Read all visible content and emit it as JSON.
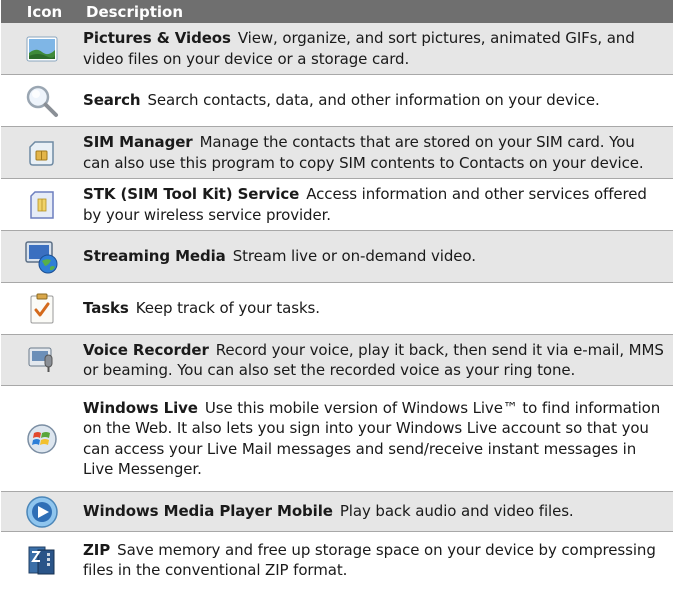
{
  "header": {
    "icon": "Icon",
    "description": "Description"
  },
  "rows": [
    {
      "icon": "pictures-videos-icon",
      "name": "Pictures & Videos",
      "text": "View, organize, and sort pictures, animated GIFs, and video files on your device or a storage card."
    },
    {
      "icon": "search-icon",
      "name": "Search",
      "text": "Search contacts, data, and other information on your device."
    },
    {
      "icon": "sim-manager-icon",
      "name": "SIM Manager",
      "text": "Manage the contacts that are stored on your SIM card. You can also use this program to copy SIM contents to Contacts on your device."
    },
    {
      "icon": "stk-service-icon",
      "name": "STK (SIM Tool Kit) Service",
      "text": "Access information and other services offered by your wireless service provider."
    },
    {
      "icon": "streaming-media-icon",
      "name": "Streaming Media",
      "text": "Stream live or on-demand video."
    },
    {
      "icon": "tasks-icon",
      "name": "Tasks",
      "text": "Keep track of your tasks."
    },
    {
      "icon": "voice-recorder-icon",
      "name": "Voice Recorder",
      "text": "Record your voice, play it back, then send it via e-mail, MMS or beaming. You can also set the recorded voice as your ring tone."
    },
    {
      "icon": "windows-live-icon",
      "name": "Windows Live",
      "text": "Use this mobile version of Windows Live™ to find information on the Web. It also lets you sign into your Windows Live account so that you can access your Live Mail messages and send/receive instant messages in Live Messenger."
    },
    {
      "icon": "windows-media-player-icon",
      "name": "Windows Media Player Mobile",
      "text": "Play back audio and video files."
    },
    {
      "icon": "zip-icon",
      "name": "ZIP",
      "text": "Save memory and free up storage space on your device by compressing files in the conventional ZIP format."
    }
  ]
}
